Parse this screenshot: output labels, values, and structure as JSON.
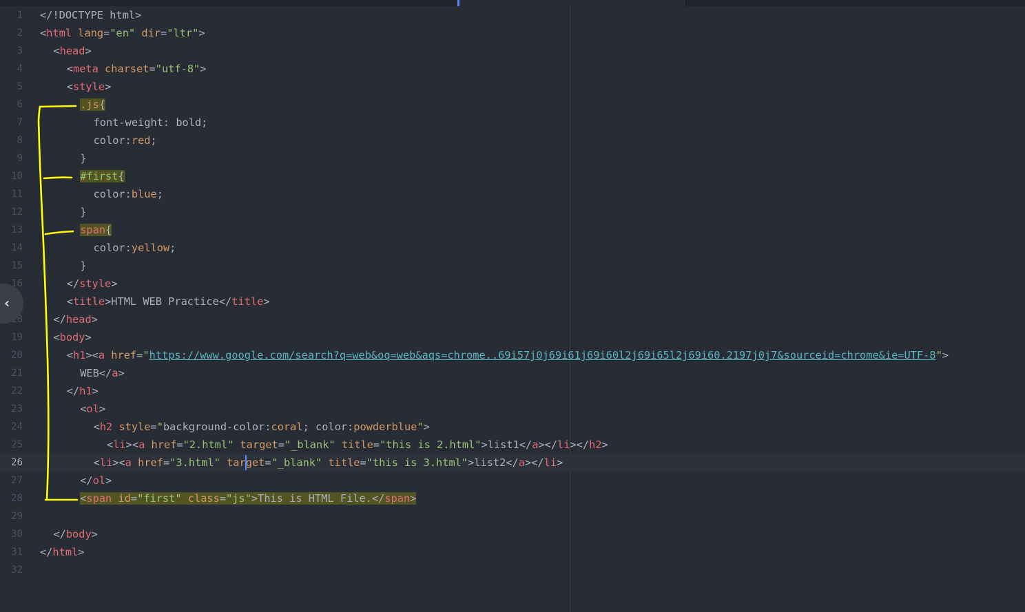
{
  "editor": {
    "cursor_line": 26,
    "lines": [
      {
        "n": "1",
        "indent": 0,
        "tokens": [
          [
            "p",
            "</!DOCTYPE html>"
          ]
        ]
      },
      {
        "n": "2",
        "indent": 0,
        "tokens": [
          [
            "p",
            "<"
          ],
          [
            "t",
            "html"
          ],
          [
            "p",
            " "
          ],
          [
            "a",
            "lang"
          ],
          [
            "p",
            "="
          ],
          [
            "s",
            "\"en\""
          ],
          [
            "p",
            " "
          ],
          [
            "a",
            "dir"
          ],
          [
            "p",
            "="
          ],
          [
            "s",
            "\"ltr\""
          ],
          [
            "p",
            ">"
          ]
        ]
      },
      {
        "n": "3",
        "indent": 1,
        "tokens": [
          [
            "p",
            "<"
          ],
          [
            "t",
            "head"
          ],
          [
            "p",
            ">"
          ]
        ]
      },
      {
        "n": "4",
        "indent": 2,
        "tokens": [
          [
            "p",
            "<"
          ],
          [
            "t",
            "meta"
          ],
          [
            "p",
            " "
          ],
          [
            "a",
            "charset"
          ],
          [
            "p",
            "="
          ],
          [
            "s",
            "\"utf-8\""
          ],
          [
            "p",
            ">"
          ]
        ]
      },
      {
        "n": "5",
        "indent": 2,
        "tokens": [
          [
            "p",
            "<"
          ],
          [
            "t",
            "style"
          ],
          [
            "p",
            ">"
          ]
        ]
      },
      {
        "n": "6",
        "indent": 3,
        "hl": true,
        "tokens": [
          [
            "c",
            ".js"
          ],
          [
            "p",
            "{"
          ]
        ]
      },
      {
        "n": "7",
        "indent": 4,
        "tokens": [
          [
            "k",
            "font-weight: bold;"
          ]
        ]
      },
      {
        "n": "8",
        "indent": 4,
        "tokens": [
          [
            "k",
            "color:"
          ],
          [
            "v",
            "red"
          ],
          [
            "k",
            ";"
          ]
        ]
      },
      {
        "n": "9",
        "indent": 3,
        "tokens": [
          [
            "p",
            "}"
          ]
        ]
      },
      {
        "n": "10",
        "indent": 3,
        "hl": true,
        "tokens": [
          [
            "i",
            "#first"
          ],
          [
            "p",
            "{"
          ]
        ]
      },
      {
        "n": "11",
        "indent": 4,
        "tokens": [
          [
            "k",
            "color:"
          ],
          [
            "v",
            "blue"
          ],
          [
            "k",
            ";"
          ]
        ]
      },
      {
        "n": "12",
        "indent": 3,
        "tokens": [
          [
            "p",
            "}"
          ]
        ]
      },
      {
        "n": "13",
        "indent": 3,
        "hl": true,
        "tokens": [
          [
            "t",
            "span"
          ],
          [
            "p",
            "{"
          ]
        ]
      },
      {
        "n": "14",
        "indent": 4,
        "tokens": [
          [
            "k",
            "color:"
          ],
          [
            "v",
            "yellow"
          ],
          [
            "k",
            ";"
          ]
        ]
      },
      {
        "n": "15",
        "indent": 3,
        "tokens": [
          [
            "p",
            "}"
          ]
        ]
      },
      {
        "n": "16",
        "indent": 2,
        "tokens": [
          [
            "p",
            "</"
          ],
          [
            "t",
            "style"
          ],
          [
            "p",
            ">"
          ]
        ]
      },
      {
        "n": "17",
        "indent": 2,
        "tokens": [
          [
            "p",
            "<"
          ],
          [
            "t",
            "title"
          ],
          [
            "p",
            ">HTML WEB Practice</"
          ],
          [
            "t",
            "title"
          ],
          [
            "p",
            ">"
          ]
        ]
      },
      {
        "n": "18",
        "indent": 1,
        "tokens": [
          [
            "p",
            "</"
          ],
          [
            "t",
            "head"
          ],
          [
            "p",
            ">"
          ]
        ]
      },
      {
        "n": "19",
        "indent": 1,
        "tokens": [
          [
            "p",
            "<"
          ],
          [
            "t",
            "body"
          ],
          [
            "p",
            ">"
          ]
        ]
      },
      {
        "n": "20",
        "indent": 2,
        "tokens": [
          [
            "p",
            "<"
          ],
          [
            "t",
            "h1"
          ],
          [
            "p",
            "><"
          ],
          [
            "t",
            "a"
          ],
          [
            "p",
            " "
          ],
          [
            "a",
            "href"
          ],
          [
            "p",
            "="
          ],
          [
            "s",
            "\""
          ],
          [
            "u",
            "https://www.google.com/search?q=web&oq=web&aqs=chrome..69i57j0j69i61j69i60l2j69i65l2j69i60.2197j0j7&sourceid=chrome&ie=UTF-8"
          ],
          [
            "s",
            "\""
          ],
          [
            "p",
            ">"
          ]
        ]
      },
      {
        "n": "21",
        "indent": 3,
        "tokens": [
          [
            "p",
            "WEB</"
          ],
          [
            "t",
            "a"
          ],
          [
            "p",
            ">"
          ]
        ]
      },
      {
        "n": "22",
        "indent": 2,
        "tokens": [
          [
            "p",
            "</"
          ],
          [
            "t",
            "h1"
          ],
          [
            "p",
            ">"
          ]
        ]
      },
      {
        "n": "23",
        "indent": 3,
        "tokens": [
          [
            "p",
            "<"
          ],
          [
            "t",
            "ol"
          ],
          [
            "p",
            ">"
          ]
        ]
      },
      {
        "n": "24",
        "indent": 4,
        "tokens": [
          [
            "p",
            "<"
          ],
          [
            "t",
            "h2"
          ],
          [
            "p",
            " "
          ],
          [
            "a",
            "style"
          ],
          [
            "p",
            "="
          ],
          [
            "s",
            "\""
          ],
          [
            "k",
            "background-color:"
          ],
          [
            "v",
            "coral"
          ],
          [
            "k",
            "; color:"
          ],
          [
            "v",
            "powderblue"
          ],
          [
            "s",
            "\""
          ],
          [
            "p",
            ">"
          ]
        ]
      },
      {
        "n": "25",
        "indent": 5,
        "tokens": [
          [
            "p",
            "<"
          ],
          [
            "t",
            "li"
          ],
          [
            "p",
            "><"
          ],
          [
            "t",
            "a"
          ],
          [
            "p",
            " "
          ],
          [
            "a",
            "href"
          ],
          [
            "p",
            "="
          ],
          [
            "s",
            "\"2.html\""
          ],
          [
            "p",
            " "
          ],
          [
            "a",
            "target"
          ],
          [
            "p",
            "="
          ],
          [
            "s",
            "\"_blank\""
          ],
          [
            "p",
            " "
          ],
          [
            "a",
            "title"
          ],
          [
            "p",
            "="
          ],
          [
            "s",
            "\"this is 2.html\""
          ],
          [
            "p",
            ">list1</"
          ],
          [
            "t",
            "a"
          ],
          [
            "p",
            "></"
          ],
          [
            "t",
            "li"
          ],
          [
            "p",
            "></"
          ],
          [
            "t",
            "h2"
          ],
          [
            "p",
            ">"
          ]
        ]
      },
      {
        "n": "26",
        "indent": 4,
        "tokens": [
          [
            "p",
            "<"
          ],
          [
            "t",
            "li"
          ],
          [
            "p",
            "><"
          ],
          [
            "t",
            "a"
          ],
          [
            "p",
            " "
          ],
          [
            "a",
            "href"
          ],
          [
            "p",
            "="
          ],
          [
            "s",
            "\"3.html\""
          ],
          [
            "p",
            " "
          ],
          [
            "a",
            "target"
          ],
          [
            "p",
            "="
          ],
          [
            "s",
            "\"_blank\""
          ],
          [
            "p",
            " "
          ],
          [
            "a",
            "title"
          ],
          [
            "p",
            "="
          ],
          [
            "s",
            "\"this is 3.html\""
          ],
          [
            "p",
            ">list2</"
          ],
          [
            "t",
            "a"
          ],
          [
            "p",
            "></"
          ],
          [
            "t",
            "li"
          ],
          [
            "p",
            ">"
          ]
        ]
      },
      {
        "n": "27",
        "indent": 3,
        "tokens": [
          [
            "p",
            "</"
          ],
          [
            "t",
            "ol"
          ],
          [
            "p",
            ">"
          ]
        ]
      },
      {
        "n": "28",
        "indent": 3,
        "hl": true,
        "tokens": [
          [
            "p",
            "<"
          ],
          [
            "t",
            "span"
          ],
          [
            "p",
            " "
          ],
          [
            "a",
            "id"
          ],
          [
            "p",
            "="
          ],
          [
            "s",
            "\"first\""
          ],
          [
            "p",
            " "
          ],
          [
            "a",
            "class"
          ],
          [
            "p",
            "="
          ],
          [
            "s",
            "\"js\""
          ],
          [
            "p",
            ">This is HTML File.</"
          ],
          [
            "t",
            "span"
          ],
          [
            "p",
            ">"
          ]
        ]
      },
      {
        "n": "29",
        "indent": 0,
        "tokens": []
      },
      {
        "n": "30",
        "indent": 1,
        "tokens": [
          [
            "p",
            "</"
          ],
          [
            "t",
            "body"
          ],
          [
            "p",
            ">"
          ]
        ]
      },
      {
        "n": "31",
        "indent": 0,
        "tokens": [
          [
            "p",
            "</"
          ],
          [
            "t",
            "html"
          ],
          [
            "p",
            ">"
          ]
        ]
      },
      {
        "n": "32",
        "indent": 0,
        "tokens": []
      }
    ]
  },
  "sidebar_toggle": {
    "icon": "chevron-left-icon",
    "glyph": "‹"
  },
  "colors": {
    "background": "#282c34",
    "tag": "#e06c75",
    "attribute": "#d19a66",
    "string": "#98c379",
    "link": "#56b6c2",
    "annotation": "#ffff00",
    "highlight": "#6b6b00"
  }
}
